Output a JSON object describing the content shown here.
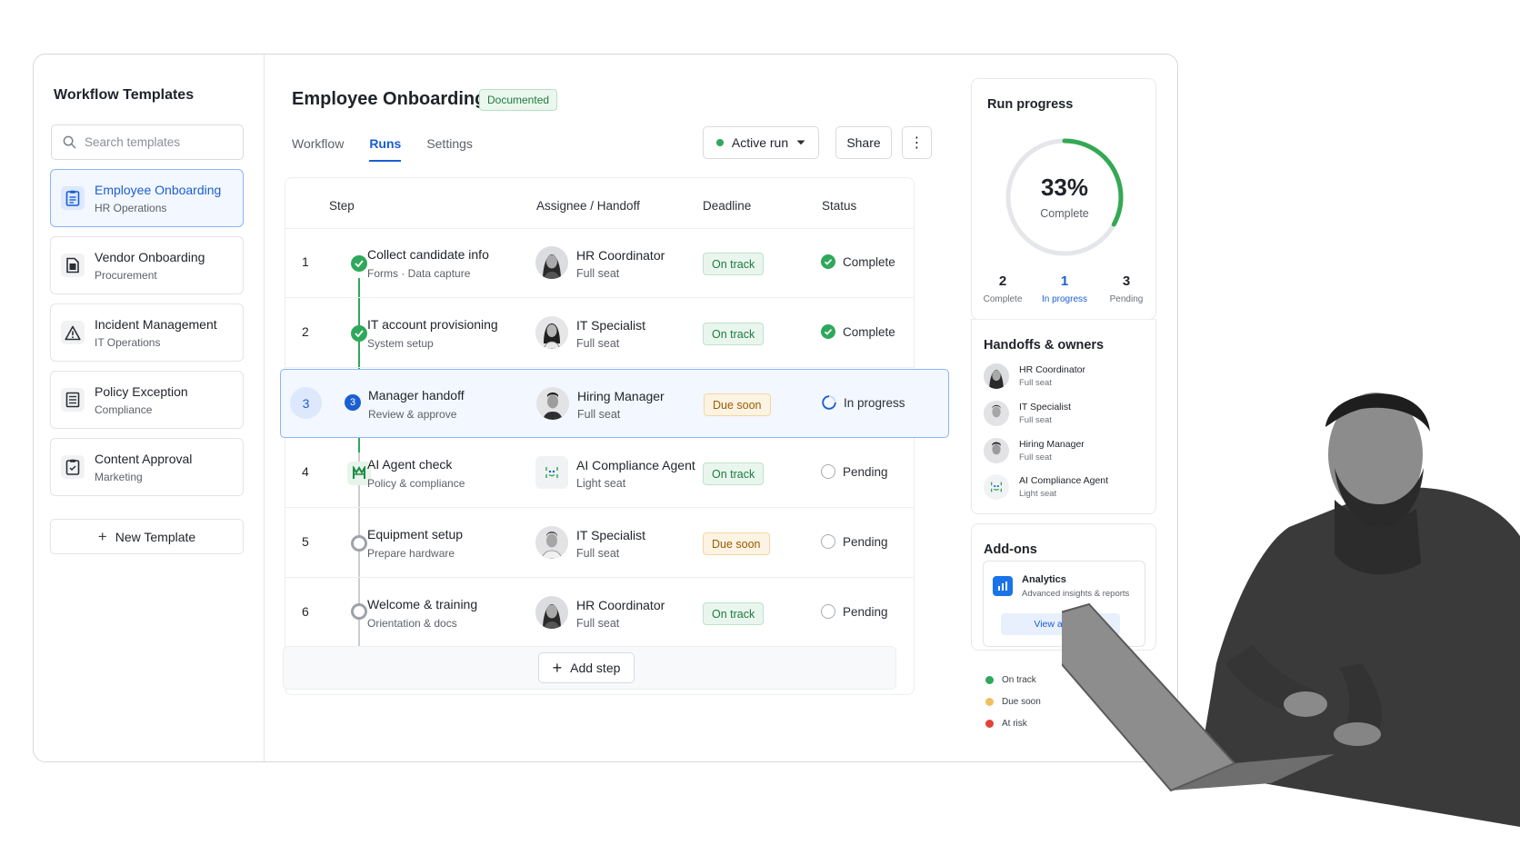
{
  "sidebar": {
    "title": "Workflow Templates",
    "search_placeholder": "Search templates",
    "templates": [
      {
        "name": "Employee Onboarding",
        "team": "HR Operations",
        "icon": "clipboard-doc-icon",
        "active": true
      },
      {
        "name": "Vendor Onboarding",
        "team": "Procurement",
        "icon": "document-icon",
        "active": false
      },
      {
        "name": "Incident Management",
        "team": "IT Operations",
        "icon": "alert-triangle-icon",
        "active": false
      },
      {
        "name": "Policy Exception",
        "team": "Compliance",
        "icon": "checklist-icon",
        "active": false
      },
      {
        "name": "Content Approval",
        "team": "Marketing",
        "icon": "clipboard-check-icon",
        "active": false
      }
    ],
    "new_template": "New Template"
  },
  "header": {
    "title": "Employee Onboarding",
    "badge": "Documented",
    "tabs": [
      "Workflow",
      "Runs",
      "Settings"
    ],
    "active_tab": "Runs",
    "active_run_label": "Active run",
    "share_label": "Share",
    "more_label": "⋮"
  },
  "table": {
    "columns": [
      "Step",
      "Assignee / Handoff",
      "Deadline",
      "Status"
    ],
    "rows": [
      {
        "num": "1",
        "step": "Collect candidate info",
        "sub": "Forms · Data capture",
        "assignee": "HR Coordinator",
        "seat": "Full seat",
        "deadline": "On track",
        "status": "Complete"
      },
      {
        "num": "2",
        "step": "IT account provisioning",
        "sub": "System setup",
        "assignee": "IT Specialist",
        "seat": "Full seat",
        "deadline": "On track",
        "status": "Complete"
      },
      {
        "num": "3",
        "step": "Manager handoff",
        "sub": "Review & approve",
        "assignee": "Hiring Manager",
        "seat": "Full seat",
        "deadline": "Due soon",
        "status": "In progress"
      },
      {
        "num": "4",
        "step": "AI Agent check",
        "sub": "Policy & compliance",
        "assignee": "AI Compliance Agent",
        "seat": "Light seat",
        "deadline": "On track",
        "status": "Pending"
      },
      {
        "num": "5",
        "step": "Equipment setup",
        "sub": "Prepare hardware",
        "assignee": "IT Specialist",
        "seat": "Full seat",
        "deadline": "Due soon",
        "status": "Pending"
      },
      {
        "num": "6",
        "step": "Welcome & training",
        "sub": "Orientation & docs",
        "assignee": "HR Coordinator",
        "seat": "Full seat",
        "deadline": "On track",
        "status": "Pending"
      }
    ],
    "add_step": "Add step"
  },
  "run_progress": {
    "title": "Run progress",
    "percent_label": "33%",
    "percent": 0.33,
    "sub_label": "Complete",
    "stats": [
      {
        "value": "2",
        "label": "Complete"
      },
      {
        "value": "1",
        "label": "In progress"
      },
      {
        "value": "3",
        "label": "Pending"
      }
    ]
  },
  "handoffs": {
    "title": "Handoffs & owners",
    "owners": [
      {
        "name": "HR Coordinator",
        "seat": "Full seat"
      },
      {
        "name": "IT Specialist",
        "seat": "Full seat"
      },
      {
        "name": "Hiring Manager",
        "seat": "Full seat"
      },
      {
        "name": "AI Compliance Agent",
        "seat": "Light seat"
      }
    ]
  },
  "addons": {
    "title": "Add-ons",
    "name": "Analytics",
    "desc": "Advanced insights & reports",
    "button": "View add-on"
  },
  "legend": [
    {
      "label": "On track",
      "color": "#2fa85b"
    },
    {
      "label": "Due soon",
      "color": "#f0c060"
    },
    {
      "label": "At risk",
      "color": "#e0443a"
    }
  ],
  "colors": {
    "accent": "#1a5fd0",
    "success": "#2fa85b",
    "warning": "#f0c060"
  }
}
